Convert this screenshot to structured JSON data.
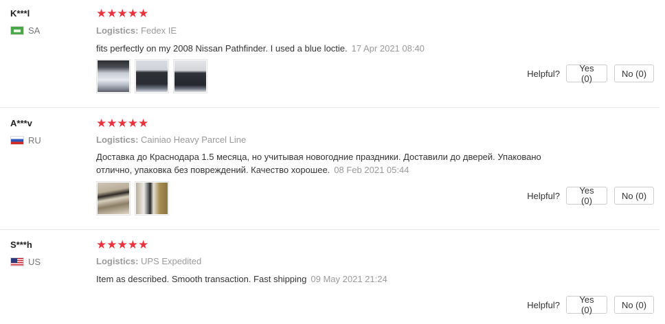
{
  "helpful_label": "Helpful?",
  "reviews": [
    {
      "user": "K***l",
      "country": "SA",
      "rating": "★★★★★",
      "logistics_label": "Logistics:",
      "logistics_value": "Fedex IE",
      "comment": "fits perfectly on my 2008 Nissan Pathfinder. I used a blue loctie.",
      "time": "17 Apr 2021 08:40",
      "yes": "Yes (0)",
      "no": "No (0)"
    },
    {
      "user": "A***v",
      "country": "RU",
      "rating": "★★★★★",
      "logistics_label": "Logistics:",
      "logistics_value": "Cainiao Heavy Parcel Line",
      "comment": "Доставка до Краснодара 1.5 месяца, но учитывая новогодние праздники. Доставили до дверей. Упаковано отлично, упаковка без повреждений. Качество хорошее.",
      "time": "08 Feb 2021 05:44",
      "yes": "Yes (0)",
      "no": "No (0)"
    },
    {
      "user": "S***h",
      "country": "US",
      "rating": "★★★★★",
      "logistics_label": "Logistics:",
      "logistics_value": "UPS Expedited",
      "comment": "Item as described. Smooth transaction. Fast shipping",
      "time": "09 May 2021 21:24",
      "yes": "Yes (0)",
      "no": "No (0)"
    }
  ],
  "colors": {
    "star": "#e9343f",
    "muted_text": "#999999",
    "divider": "#e8e8e8"
  }
}
